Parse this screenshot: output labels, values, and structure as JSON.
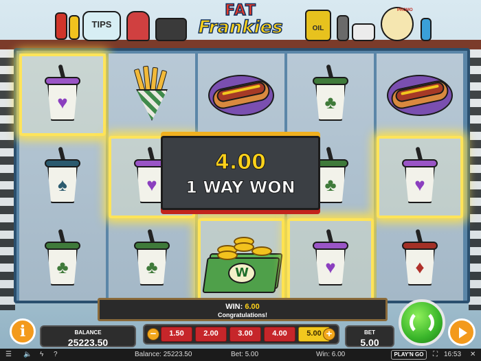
{
  "game": {
    "logo_line1": "FAT",
    "logo_line2": "Frankies",
    "background_props": {
      "tips_jar": "TIPS",
      "oil_can": "OIL",
      "promo_badge": "PROMO"
    }
  },
  "reels": [
    [
      "heart-cup",
      "spade-cup",
      "club-cup"
    ],
    [
      "fries",
      "heart-cup",
      "club-cup"
    ],
    [
      "hotdog",
      "empty",
      "money-scatter"
    ],
    [
      "club-cup",
      "club-cup",
      "heart-cup"
    ],
    [
      "hotdog",
      "heart-cup",
      "diamond-cup"
    ]
  ],
  "winning_cells": [
    [
      0,
      0
    ],
    [
      1,
      1
    ],
    [
      2,
      2
    ],
    [
      3,
      2
    ],
    [
      4,
      1
    ]
  ],
  "win_banner": {
    "amount": "4.00",
    "caption": "1 WAY WON"
  },
  "message_bar": {
    "win_label": "WIN:",
    "win_value": "6.00",
    "message": "Congratulations!"
  },
  "controls": {
    "info_label": "i",
    "balance_label": "BALANCE",
    "balance_value": "25223.50",
    "bet_label": "BET",
    "bet_value": "5.00",
    "minus": "−",
    "plus": "+",
    "bet_options": [
      "1.50",
      "2.00",
      "3.00",
      "4.00",
      "5.00"
    ],
    "selected_bet": "5.00"
  },
  "footer": {
    "balance_text": "Balance: 25223.50",
    "bet_text": "Bet: 5.00",
    "win_text": "Win: 6.00",
    "brand": "PLAY'N GO",
    "time": "16:53",
    "help": "?",
    "close": "✕"
  },
  "colors": {
    "win_highlight": "#ffe45a",
    "spin_button": "#39b52a",
    "accent_orange": "#f39a1c",
    "bet_chip": "#c6262a",
    "bet_chip_selected": "#f2c81e"
  }
}
